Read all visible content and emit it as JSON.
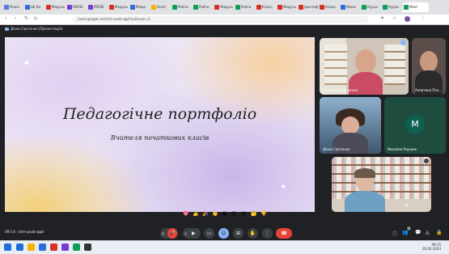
{
  "browser": {
    "tabs": [
      {
        "label": "Розкл",
        "color": "#5a7bd8"
      },
      {
        "label": "ШІ Ка",
        "color": "#2d6cdf"
      },
      {
        "label": "Модуль",
        "color": "#d93025"
      },
      {
        "label": "PRESE",
        "color": "#7a3ad8"
      },
      {
        "label": "PRESE",
        "color": "#7a3ad8"
      },
      {
        "label": "Модуль",
        "color": "#d93025"
      },
      {
        "label": "Мікро",
        "color": "#2d6cdf"
      },
      {
        "label": "Освіт",
        "color": "#f4b400"
      },
      {
        "label": "Рейти",
        "color": "#0f9d58"
      },
      {
        "label": "Рейти",
        "color": "#0f9d58"
      },
      {
        "label": "Модуль",
        "color": "#d93025"
      },
      {
        "label": "Рейти",
        "color": "#0f9d58"
      },
      {
        "label": "Класн",
        "color": "#d93025"
      },
      {
        "label": "Модуль",
        "color": "#d93025"
      },
      {
        "label": "Ідентиф",
        "color": "#d93025"
      },
      {
        "label": "Класи",
        "color": "#d93025"
      },
      {
        "label": "Меню",
        "color": "#2d6cdf"
      },
      {
        "label": "Курси",
        "color": "#0f9d58"
      },
      {
        "label": "Курси",
        "color": "#0f9d58"
      },
      {
        "label": "Meet",
        "color": "#0f9d58"
      }
    ],
    "url": "meet.google.com/klm-pezb-qqd?authuser=1"
  },
  "presentation": {
    "presenter_label": "Діана Сергієнко (Презентація)",
    "slide_title": "Педагогічне портфоліо",
    "slide_subtitle": "Вчителя початкових класів"
  },
  "participants": [
    {
      "name": "Наталія Бондаренко",
      "initial": ""
    },
    {
      "name": "Алевтина Пал...",
      "initial": ""
    },
    {
      "name": "Діана Сергієнко",
      "initial": ""
    },
    {
      "name": "Михайло Коржик",
      "initial": "M"
    },
    {
      "name": "",
      "initial": ""
    }
  ],
  "meeting": {
    "time": "09:14",
    "code": "klm-pezb-qqd",
    "reactions": [
      "💖",
      "👍",
      "🎉",
      "👏",
      "😂",
      "😮",
      "😢",
      "🤔",
      "👎"
    ],
    "controls": [
      "⋀",
      "🎤",
      "⋀",
      "📷",
      "⊞",
      "☺",
      "▭",
      "✋",
      "⋮",
      "☎"
    ],
    "right_icons": [
      "ⓘ",
      "👥",
      "💬",
      "◬",
      "🔒"
    ],
    "participant_count": "9"
  },
  "taskbar": {
    "time": "09:15",
    "date": "26.02.2024",
    "apps": [
      "#1e6fd9",
      "#f4b400",
      "#2d6cdf",
      "#d93025",
      "#7a3ad8",
      "#0f9d58",
      "#333333"
    ]
  },
  "colors": {
    "end_call": "#ea4335",
    "accent_blue": "#8ab4f8",
    "mic_off": "#ea4335"
  }
}
